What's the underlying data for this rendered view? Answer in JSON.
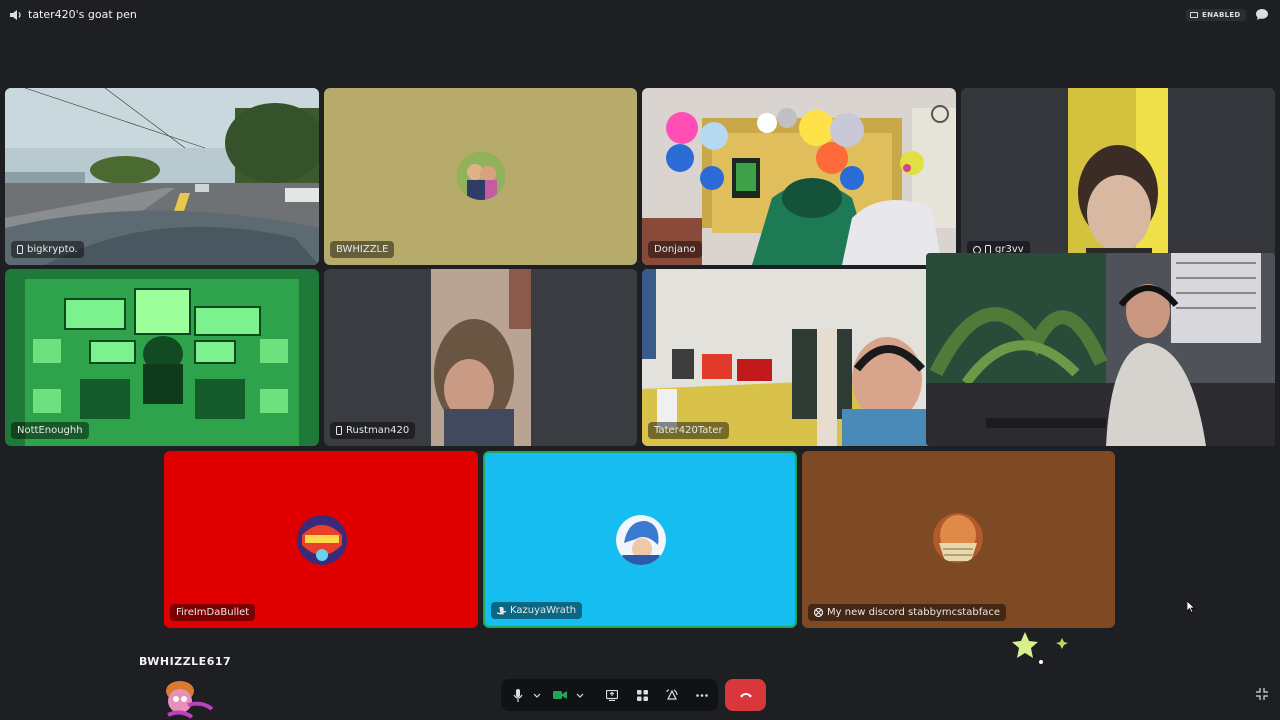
{
  "header": {
    "channel_name": "tater420's goat pen",
    "stream_badge": "ENABLED"
  },
  "tiles": {
    "bigkrypto": {
      "name": "bigkrypto."
    },
    "bwhizzle": {
      "name": "BWHIZZLE",
      "bg_color": "#b6ab6b"
    },
    "donjano": {
      "name": "Donjano"
    },
    "gr3vv": {
      "name": "gr3vv"
    },
    "nottenough": {
      "name": "NottEnoughh"
    },
    "rustman": {
      "name": "Rustman420"
    },
    "tater": {
      "name": "Tater420Tater"
    },
    "fireimdabullet": {
      "name": "FireImDaBullet",
      "bg_color": "#e00000"
    },
    "kazuyawrath": {
      "name": "KazuyaWrath",
      "bg_color": "#15bdf1",
      "speaking_color": "#23a559"
    },
    "stabby": {
      "name": "My new discord stabbymcstabface",
      "bg_color": "#7d4a23"
    }
  },
  "self_user": {
    "name": "BWHIZZLE617"
  },
  "colors": {
    "background": "#1e1f22",
    "hangup": "#da373c",
    "camera_on": "#23a559"
  },
  "icons": [
    "speaker-icon",
    "chat-icon",
    "microphone-icon",
    "camera-icon",
    "screen-share-icon",
    "activities-icon",
    "soundboard-icon",
    "more-icon",
    "hangup-icon",
    "fullscreen-icon",
    "playstation-icon",
    "xbox-icon",
    "mobile-icon"
  ]
}
